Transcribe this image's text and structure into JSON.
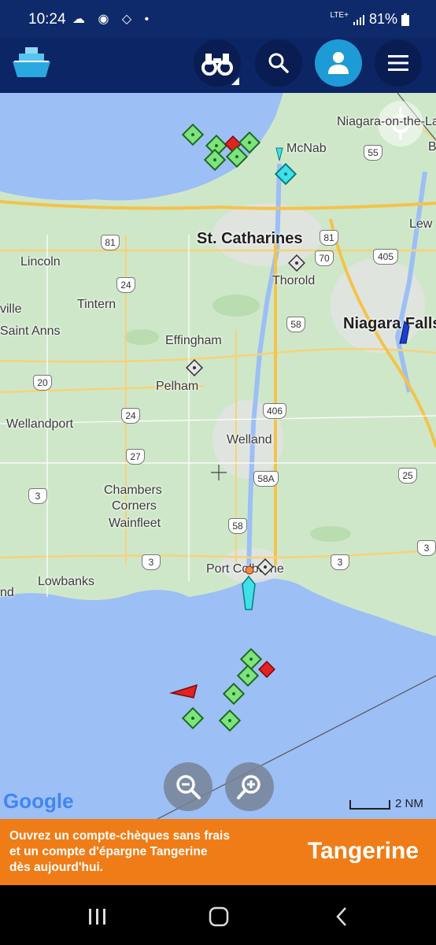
{
  "status_bar": {
    "time": "10:24",
    "network": "LTE+",
    "battery": "81%"
  },
  "header": {
    "icons": [
      "ship-logo-icon",
      "binoculars-icon",
      "search-icon",
      "user-icon",
      "menu-icon"
    ]
  },
  "map": {
    "labels": [
      {
        "text": "Niagara-on-the-Lake"
      },
      {
        "text": "McNab"
      },
      {
        "text": "St. Catharines"
      },
      {
        "text": "Lincoln"
      },
      {
        "text": "Thorold"
      },
      {
        "text": "Tintern"
      },
      {
        "text": "Niagara Falls"
      },
      {
        "text": "ville"
      },
      {
        "text": "Saint Anns"
      },
      {
        "text": "Effingham"
      },
      {
        "text": "Pelham"
      },
      {
        "text": "Wellandport"
      },
      {
        "text": "Welland"
      },
      {
        "text": "Chambers"
      },
      {
        "text": "Corners"
      },
      {
        "text": "Wainfleet"
      },
      {
        "text": "Port Colborne"
      },
      {
        "text": "Lowbanks"
      },
      {
        "text": "nd"
      },
      {
        "text": "Lew"
      },
      {
        "text": "B"
      }
    ],
    "route_shields": [
      "55",
      "81",
      "81",
      "70",
      "405",
      "24",
      "58",
      "20",
      "24",
      "406",
      "27",
      "58A",
      "25",
      "3",
      "58",
      "3",
      "3",
      "3"
    ],
    "attribution": "Google",
    "scale_label": "2 NM",
    "zoom_out_icon": "zoom-out-icon",
    "zoom_in_icon": "zoom-in-icon"
  },
  "ad": {
    "line1": "Ouvrez un compte-chèques sans frais",
    "line2": "et un compte d'épargne Tangerine",
    "line3": "dès aujourd'hui.",
    "brand": "Tangerine"
  },
  "colors": {
    "header_bg": "#0c2565",
    "map_water": "#9cbff5",
    "map_land": "#cfe7c9",
    "accent_blue": "#1e9bd6",
    "ad_orange": "#f07c17",
    "vessel_green": "#7ee27e",
    "vessel_red": "#e32222",
    "vessel_cyan": "#3fe0e8"
  }
}
